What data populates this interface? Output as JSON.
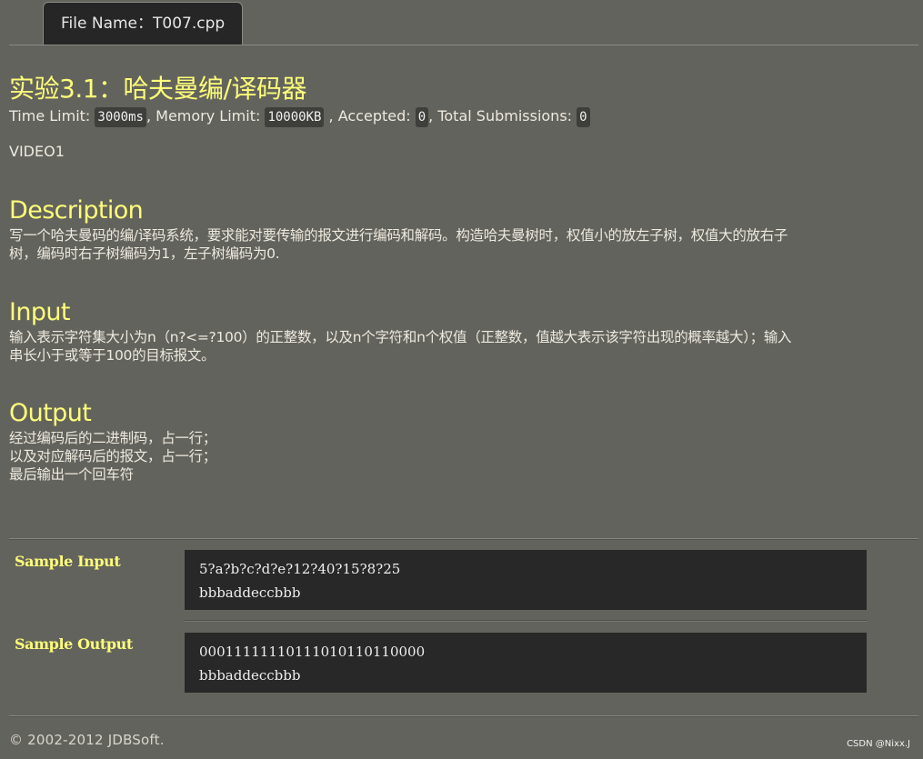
{
  "tab": {
    "label": "File Name：T007.cpp"
  },
  "problem": {
    "title": "实验3.1：哈夫曼编/译码器",
    "meta": {
      "time_label": "Time Limit: ",
      "time_value": "3000ms",
      "memory_label": ", Memory Limit: ",
      "memory_value": "10000KB",
      "accepted_label": " , Accepted: ",
      "accepted_value": "0",
      "submissions_label": ", Total Submissions: ",
      "submissions_value": "0"
    },
    "source": "VIDEO1"
  },
  "sections": {
    "description": {
      "heading": "Description",
      "lines": [
        "写一个哈夫曼码的编/译码系统，要求能对要传输的报文进行编码和解码。构造哈夫曼树时，权值小的放左子树，权值大的放右子",
        "树，编码时右子树编码为1，左子树编码为0."
      ]
    },
    "input": {
      "heading": "Input",
      "lines": [
        "输入表示字符集大小为n（n?<=?100）的正整数，以及n个字符和n个权值（正整数，值越大表示该字符出现的概率越大）；输入",
        "串长小于或等于100的目标报文。"
      ]
    },
    "output": {
      "heading": "Output",
      "lines": [
        "经过编码后的二进制码，占一行；",
        "以及对应解码后的报文，占一行；",
        "最后输出一个回车符"
      ]
    }
  },
  "samples": {
    "input": {
      "label": "Sample Input",
      "lines": [
        "5?a?b?c?d?e?12?40?15?8?25",
        "bbbaddeccbbb"
      ]
    },
    "output": {
      "label": "Sample Output",
      "lines": [
        "00011111110111010110110000",
        "bbbaddeccbbb"
      ]
    }
  },
  "footer": {
    "copyright": "© 2002-2012  JDBSoft."
  },
  "watermark": "CSDN @Nixx.J"
}
